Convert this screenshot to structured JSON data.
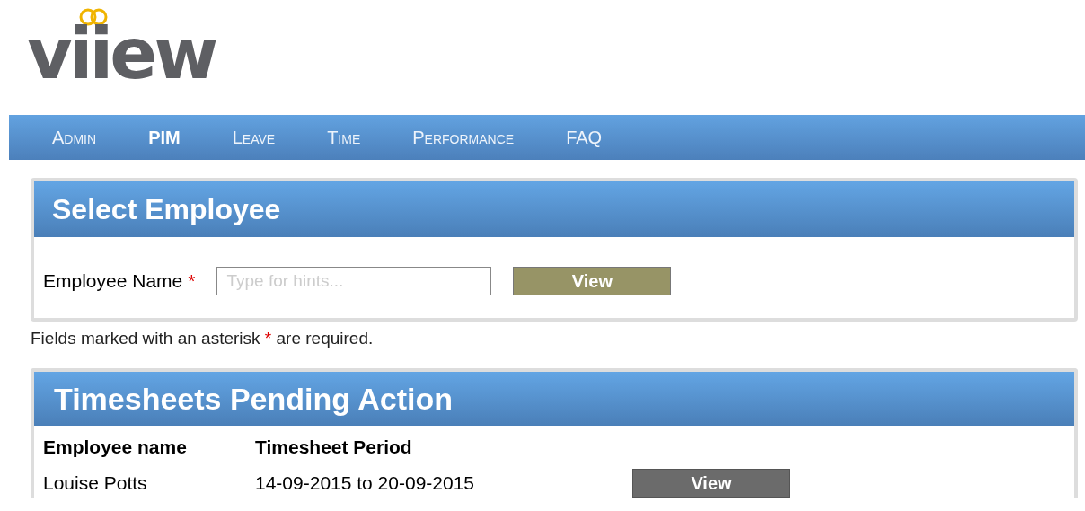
{
  "logo": {
    "text": "viiew"
  },
  "nav": [
    {
      "label": "Admin",
      "selected": false
    },
    {
      "label": "PIM",
      "selected": true
    },
    {
      "label": "Leave",
      "selected": false
    },
    {
      "label": "Time",
      "selected": false
    },
    {
      "label": "Performance",
      "selected": false
    },
    {
      "label": "FAQ",
      "selected": false
    }
  ],
  "select_panel": {
    "title": "Select Employee",
    "field_label": "Employee Name",
    "required_mark": "*",
    "placeholder": "Type for hints...",
    "button": "View"
  },
  "note": {
    "before": "Fields marked with an asterisk",
    "mark": "*",
    "after": "are required."
  },
  "pending_panel": {
    "title": "Timesheets Pending Action",
    "columns": [
      "Employee name",
      "Timesheet Period"
    ],
    "rows": [
      {
        "employee": "Louise Potts",
        "period": "14-09-2015 to 20-09-2015",
        "button": "View"
      }
    ]
  }
}
